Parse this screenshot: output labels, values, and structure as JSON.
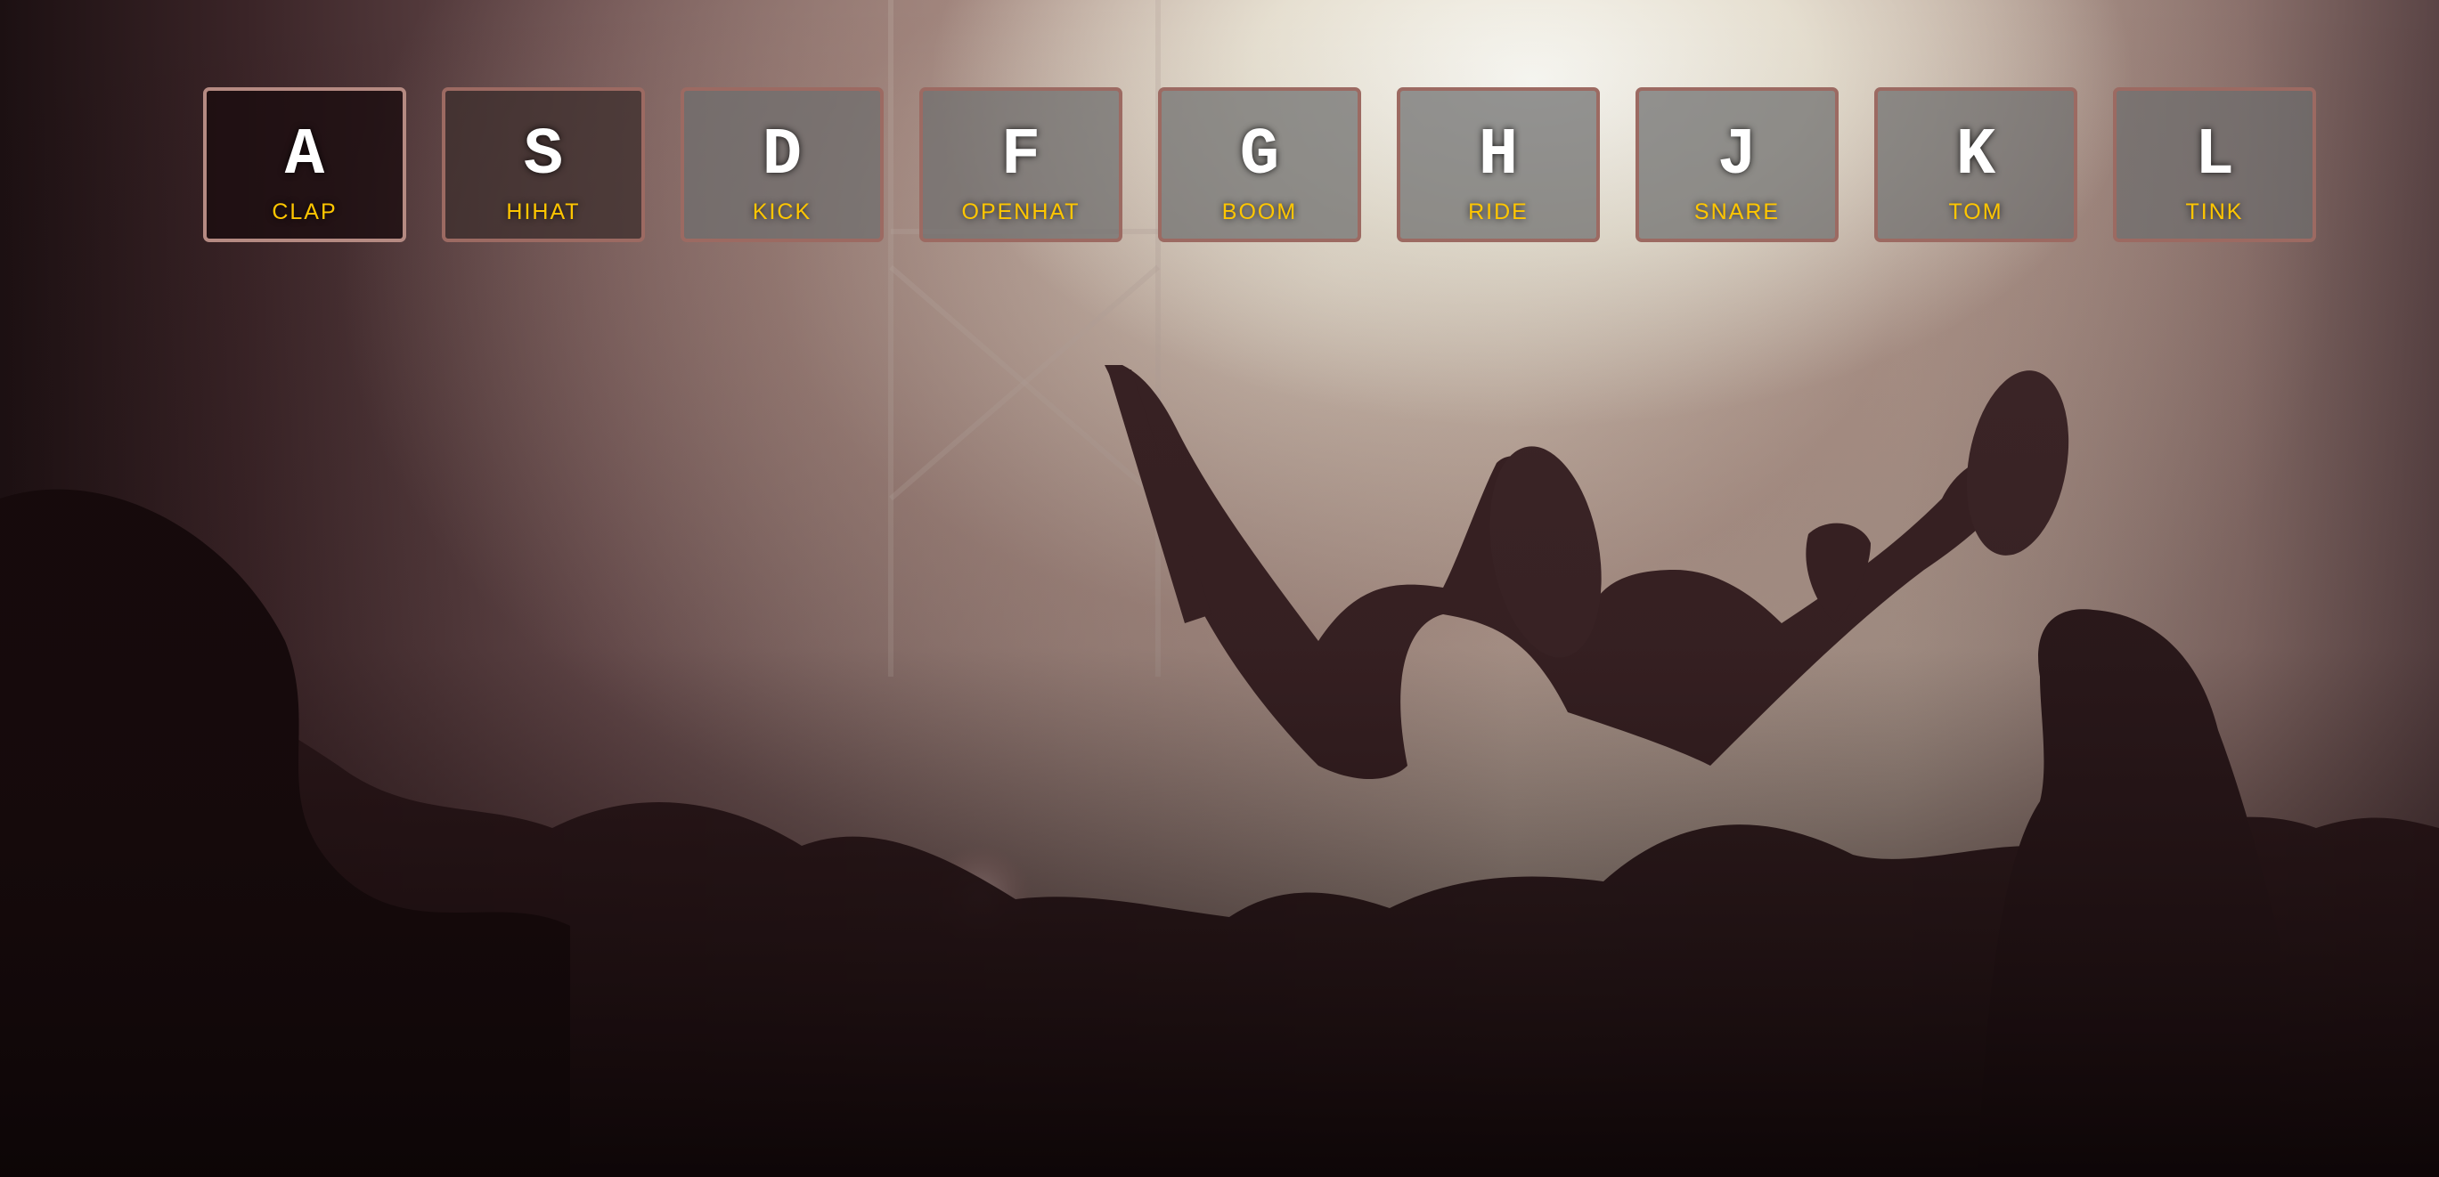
{
  "keys": [
    {
      "letter": "A",
      "sound": "CLAP"
    },
    {
      "letter": "S",
      "sound": "HIHAT"
    },
    {
      "letter": "D",
      "sound": "KICK"
    },
    {
      "letter": "F",
      "sound": "OPENHAT"
    },
    {
      "letter": "G",
      "sound": "BOOM"
    },
    {
      "letter": "H",
      "sound": "RIDE"
    },
    {
      "letter": "J",
      "sound": "SNARE"
    },
    {
      "letter": "K",
      "sound": "TOM"
    },
    {
      "letter": "L",
      "sound": "TINK"
    }
  ],
  "colors": {
    "key_border": "#9c6a62",
    "letter": "#ffffff",
    "sound_label": "#ffc600"
  },
  "background": {
    "description_icon": "concert-crowd-photo"
  }
}
